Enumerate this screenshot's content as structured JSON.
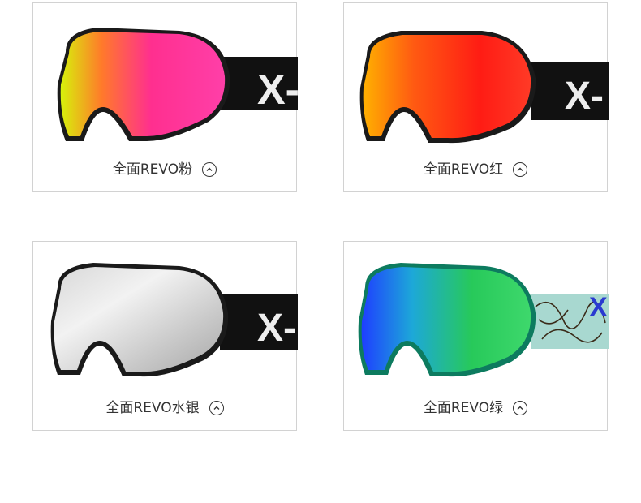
{
  "products": [
    {
      "label": "全面REVO粉",
      "strap_text": "X-",
      "lens": [
        "#d7f20b",
        "#ff5a3c",
        "#ff2f8f",
        "#ff3fa8"
      ],
      "frame": "#111111",
      "strap": "#111111"
    },
    {
      "label": "全面REVO红",
      "strap_text": "X-",
      "lens": [
        "#ffb000",
        "#ff5a12",
        "#ff1c14",
        "#ff3a26"
      ],
      "frame": "#111111",
      "strap": "#111111"
    },
    {
      "label": "全面REVO水银",
      "strap_text": "X-",
      "lens": [
        "#d8d8d8",
        "#f0f0f0",
        "#c9c9c9",
        "#a8a8a8"
      ],
      "frame": "#111111",
      "strap": "#111111"
    },
    {
      "label": "全面REVO绿",
      "strap_text": "X",
      "lens": [
        "#1e3fff",
        "#1da8d8",
        "#27c95a",
        "#3ed86c"
      ],
      "frame": "#0d7b5f",
      "strap": "#a8d8d0"
    }
  ],
  "colors": {
    "border": "#d2d2d2",
    "text": "#333333"
  }
}
